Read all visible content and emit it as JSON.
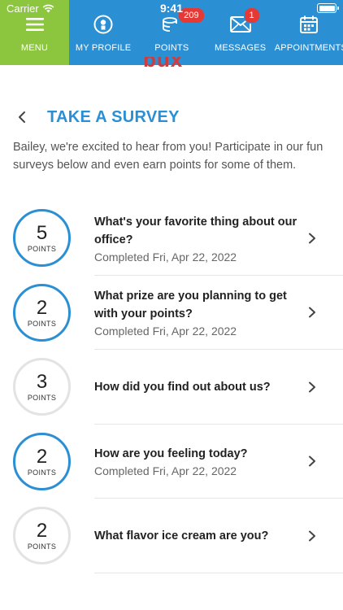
{
  "status_bar": {
    "carrier": "Carrier",
    "time": "9:41"
  },
  "nav": {
    "menu_label": "MENU",
    "items": [
      {
        "label": "MY PROFILE",
        "icon": "profile-icon"
      },
      {
        "label": "POINTS",
        "icon": "coins-icon",
        "badge": "209"
      },
      {
        "label": "MESSAGES",
        "icon": "envelope-icon",
        "badge": "1"
      },
      {
        "label": "APPOINTMENTS",
        "icon": "calendar-icon"
      }
    ]
  },
  "logo_fragment": "bux",
  "page": {
    "title": "TAKE A SURVEY",
    "intro": "Bailey, we're excited to hear from you! Participate in our fun surveys below and even earn points for some of them."
  },
  "surveys": [
    {
      "points": "5",
      "points_label": "POINTS",
      "question": "What's your favorite thing about our office?",
      "status": "Completed Fri, Apr 22, 2022",
      "completed": true
    },
    {
      "points": "2",
      "points_label": "POINTS",
      "question": "What prize are you planning to get with your points?",
      "status": "Completed Fri, Apr 22, 2022",
      "completed": true
    },
    {
      "points": "3",
      "points_label": "POINTS",
      "question": "How did you find out about us?",
      "status": "",
      "completed": false
    },
    {
      "points": "2",
      "points_label": "POINTS",
      "question": "How are you feeling today?",
      "status": "Completed Fri, Apr 22, 2022",
      "completed": true
    },
    {
      "points": "2",
      "points_label": "POINTS",
      "question": "What flavor ice cream are you?",
      "status": "",
      "completed": false
    }
  ],
  "colors": {
    "primary": "#2b8fd4",
    "menu": "#8cc63f",
    "badge": "#e53935",
    "completed_ring": "#2b8fd4",
    "pending_ring": "#e3e3e3"
  }
}
